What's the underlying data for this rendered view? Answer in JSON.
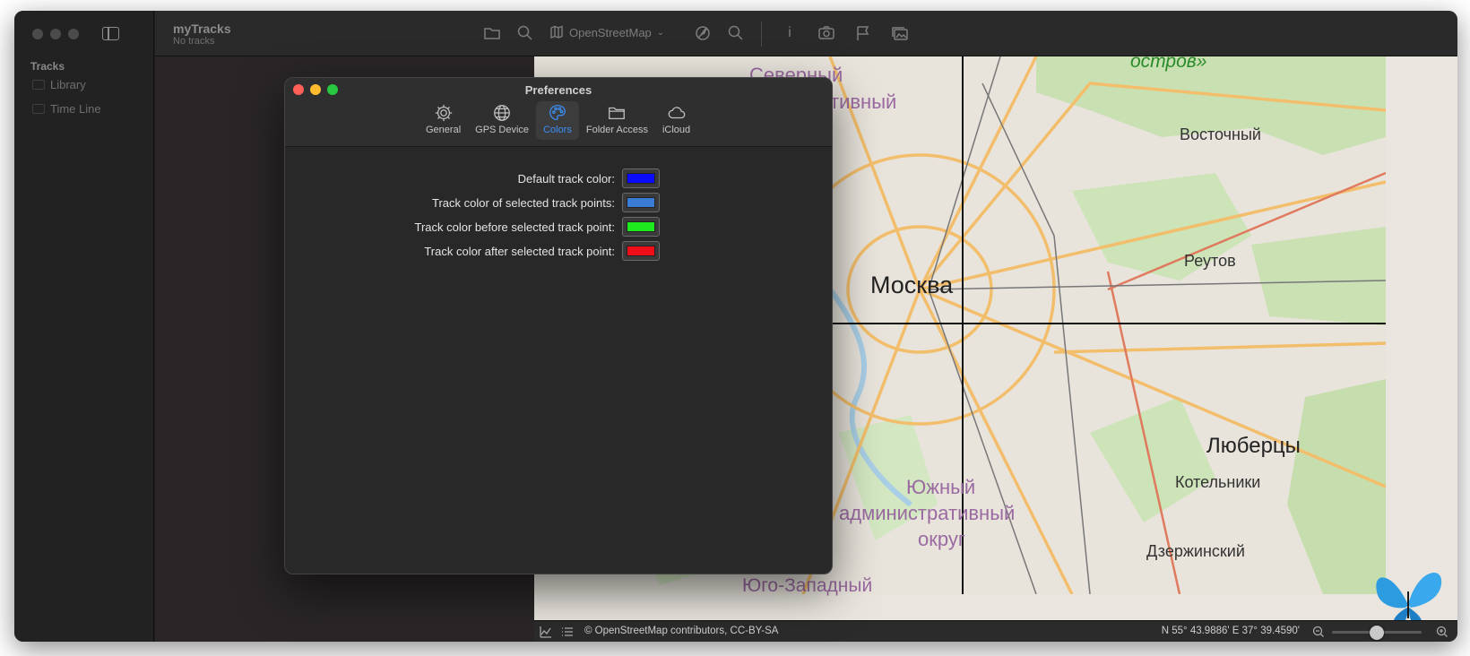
{
  "app": {
    "title": "myTracks",
    "subtitle": "No tracks"
  },
  "sidebar": {
    "heading": "Tracks",
    "items": [
      {
        "label": "Library"
      },
      {
        "label": "Time Line"
      }
    ]
  },
  "toolbar": {
    "map_source": "OpenStreetMap"
  },
  "map": {
    "labels": [
      {
        "text": "остров»",
        "color": "#2a8a2a"
      },
      {
        "text": "Северный",
        "color": "#9a6aa0"
      },
      {
        "text": "тивный",
        "color": "#9a6aa0"
      },
      {
        "text": "Восточный",
        "color": "#333333"
      },
      {
        "text": "Реутов",
        "color": "#333333"
      },
      {
        "text": "Москва",
        "color": "#222222"
      },
      {
        "text": "Люберцы",
        "color": "#222222"
      },
      {
        "text": "Котельники",
        "color": "#333333"
      },
      {
        "text": "Южный",
        "color": "#9a6aa0"
      },
      {
        "text": "административный",
        "color": "#9a6aa0"
      },
      {
        "text": "округ",
        "color": "#9a6aa0"
      },
      {
        "text": "Дзержинский",
        "color": "#333333"
      },
      {
        "text": "Юго-Западный",
        "color": "#9a6aa0"
      }
    ]
  },
  "status_bar": {
    "copyright": "© OpenStreetMap contributors, CC-BY-SA",
    "coordinates": "N 55° 43.9886' E 37° 39.4590'",
    "zoom_level": 0.5
  },
  "preferences": {
    "title": "Preferences",
    "tabs": [
      {
        "label": "General",
        "icon": "gear-icon"
      },
      {
        "label": "GPS Device",
        "icon": "globe-icon"
      },
      {
        "label": "Colors",
        "icon": "palette-icon",
        "active": true
      },
      {
        "label": "Folder Access",
        "icon": "folder-icon"
      },
      {
        "label": "iCloud",
        "icon": "cloud-icon"
      }
    ],
    "color_rows": [
      {
        "label": "Default track color:",
        "color": "#0a0aff"
      },
      {
        "label": "Track color of selected track points:",
        "color": "#3a7bd5"
      },
      {
        "label": "Track color before selected track point:",
        "color": "#1ee81e"
      },
      {
        "label": "Track color after selected track point:",
        "color": "#ef0d1a"
      }
    ]
  },
  "colors": {
    "accent": "#3b8ef5",
    "close": "#fe5f57",
    "minimize": "#febc2e",
    "zoom": "#28c840"
  }
}
